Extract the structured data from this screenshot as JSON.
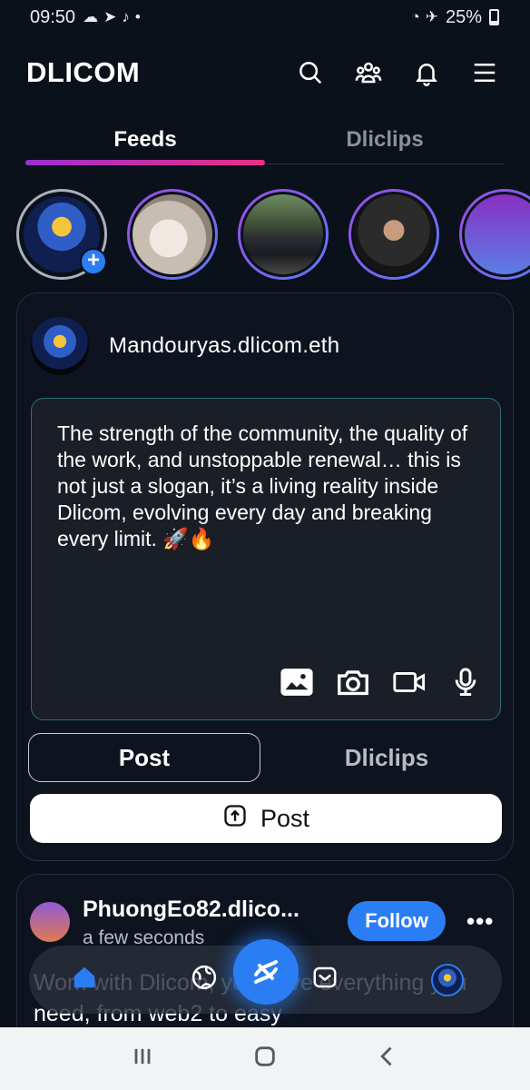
{
  "status_bar": {
    "time": "09:50",
    "battery": "25%",
    "left_icons": [
      "cloud-icon",
      "telegram-icon",
      "tiktok-icon",
      "dot-icon"
    ],
    "right_icons": [
      "wifi-icon",
      "airplane-icon",
      "battery-icon"
    ]
  },
  "header": {
    "logo": "DLICOM",
    "icons": [
      "search-icon",
      "community-icon",
      "bell-icon",
      "menu-icon"
    ]
  },
  "tabs": [
    {
      "label": "Feeds",
      "active": true
    },
    {
      "label": "Dliclips",
      "active": false
    }
  ],
  "stories": [
    {
      "name": "own-story",
      "image": "mandour-logo"
    },
    {
      "name": "story-2",
      "image": "hooded-person"
    },
    {
      "name": "story-3",
      "image": "black-suv"
    },
    {
      "name": "story-4",
      "image": "man-sunglasses"
    },
    {
      "name": "story-5",
      "image": "gradient"
    }
  ],
  "composer": {
    "username": "Mandouryas.dlicom.eth",
    "text": "The strength of the community, the quality of the work, and unstoppable renewal… this is not just a slogan, it’s a living reality inside Dlicom, evolving every day and breaking every limit. 🚀🔥",
    "media_icons": [
      "image-icon",
      "camera-icon",
      "video-icon",
      "mic-icon"
    ],
    "toggle": {
      "post": "Post",
      "dliclips": "Dliclips"
    },
    "post_button": "Post"
  },
  "feed_post": {
    "username": "PhuongEo82.dlico...",
    "time": "a few seconds",
    "follow": "Follow",
    "more": "•••",
    "text": "Work with Dlicom, you have everything you need, from web2 to easy"
  },
  "bottom_nav": [
    "home-icon",
    "explore-icon",
    "dlicom-icon",
    "messages-icon",
    "profile-avatar"
  ],
  "colors": {
    "background": "#0b111b",
    "accent": "#2b7df3",
    "tab_gradient_start": "#9b2fd0",
    "tab_gradient_end": "#ec2f83"
  }
}
